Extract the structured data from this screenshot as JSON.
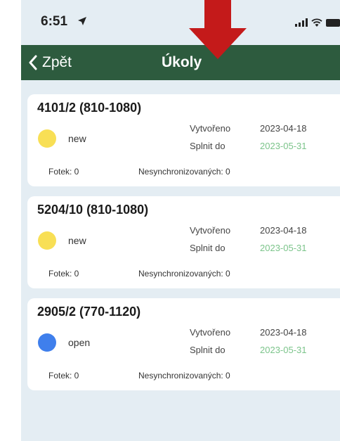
{
  "status_bar": {
    "time": "6:51"
  },
  "nav": {
    "back_label": "Zpět",
    "title": "Úkoly"
  },
  "colors": {
    "nav_background": "#2d5b3e",
    "status_new": "#f8df55",
    "status_open": "#3f7fec",
    "due_date": "#7bc48a",
    "annotation_arrow": "#c41a1a"
  },
  "tasks": [
    {
      "title": "4101/2 (810-1080)",
      "status": "new",
      "status_color": "#f8df55",
      "created_label": "Vytvořeno",
      "created": "2023-04-18",
      "due_label": "Splnit do",
      "due": "2023-05-31",
      "photos": "Fotek: 0",
      "unsynced": "Nesynchronizovaných: 0"
    },
    {
      "title": "5204/10 (810-1080)",
      "status": "new",
      "status_color": "#f8df55",
      "created_label": "Vytvořeno",
      "created": "2023-04-18",
      "due_label": "Splnit do",
      "due": "2023-05-31",
      "photos": "Fotek: 0",
      "unsynced": "Nesynchronizovaných: 0"
    },
    {
      "title": "2905/2 (770-1120)",
      "status": "open",
      "status_color": "#3f7fec",
      "created_label": "Vytvořeno",
      "created": "2023-04-18",
      "due_label": "Splnit do",
      "due": "2023-05-31",
      "photos": "Fotek: 0",
      "unsynced": "Nesynchronizovaných: 0"
    }
  ]
}
